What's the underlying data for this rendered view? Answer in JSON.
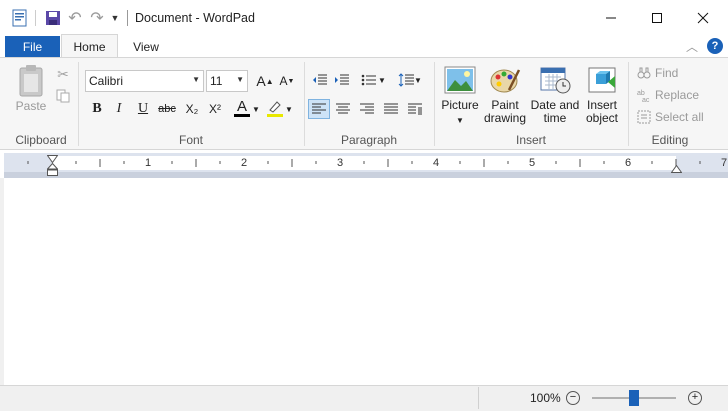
{
  "window": {
    "title": "Document - WordPad",
    "minimize_icon": "minimize-icon",
    "maximize_icon": "maximize-icon",
    "close_icon": "close-icon"
  },
  "tabs": {
    "file": "File",
    "home": "Home",
    "view": "View"
  },
  "clipboard": {
    "paste_label": "Paste",
    "group_label": "Clipboard"
  },
  "font": {
    "family": "Calibri",
    "size": "11",
    "group_label": "Font",
    "bold": "B",
    "italic": "I",
    "underline": "U",
    "strikethrough": "abc",
    "subscript": "X₂",
    "superscript": "X²",
    "color_glyph": "A"
  },
  "paragraph": {
    "group_label": "Paragraph"
  },
  "insert": {
    "group_label": "Insert",
    "picture_line1": "Picture",
    "paint_line1": "Paint",
    "paint_line2": "drawing",
    "date_line1": "Date and",
    "date_line2": "time",
    "object_line1": "Insert",
    "object_line2": "object"
  },
  "editing": {
    "group_label": "Editing",
    "find": "Find",
    "replace": "Replace",
    "select_all": "Select all"
  },
  "ruler": {
    "numbers": [
      "1",
      "2",
      "3",
      "4",
      "5",
      "6",
      "7"
    ]
  },
  "status": {
    "zoom_label": "100%",
    "zoom_value": 0.5
  },
  "colors": {
    "accent": "#1a61b8",
    "font_color": "#000000",
    "highlight": "#e8e800"
  }
}
